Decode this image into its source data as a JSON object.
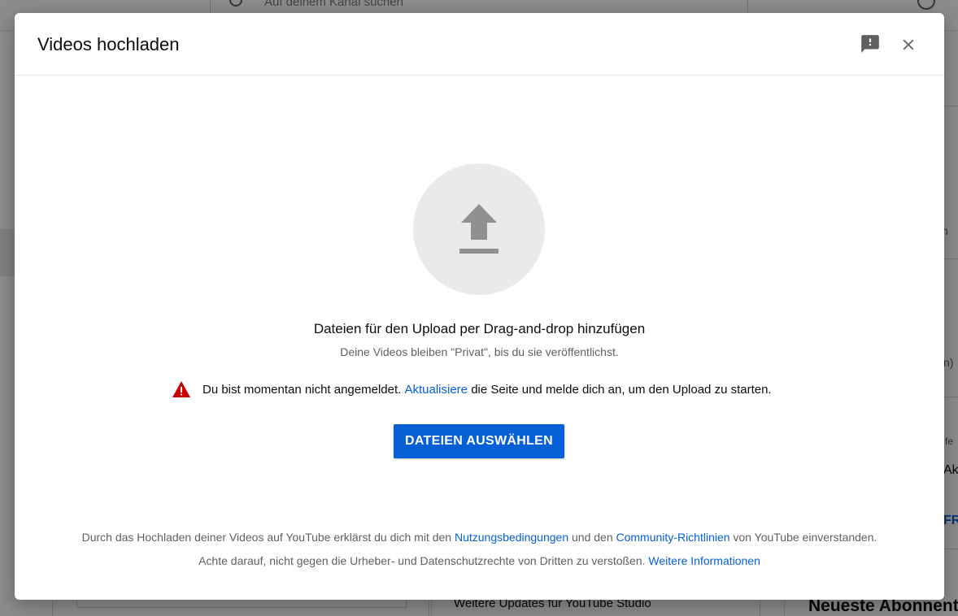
{
  "background": {
    "search_placeholder": "Auf deinem Kanal suchen",
    "updates_heading": "Weitere Updates für YouTube Studio",
    "subscribers_heading": "Neueste Abonnenten",
    "fragments": [
      "n",
      "n)",
      "fe",
      "Ak",
      "FR"
    ]
  },
  "dialog": {
    "title": "Videos hochladen",
    "feedback_icon": "feedback-icon",
    "close_icon": "close-icon",
    "upload_icon": "upload-arrow-icon",
    "drop_title": "Dateien für den Upload per Drag-and-drop hinzufügen",
    "drop_subtitle": "Deine Videos bleiben \"Privat\", bis du sie veröffentlichst.",
    "warning": {
      "icon": "warning-icon",
      "text_before": "Du bist momentan nicht angemeldet.",
      "link": "Aktualisiere",
      "text_after": "die Seite und melde dich an, um den Upload zu starten."
    },
    "select_button": "DATEIEN AUSWÄHLEN",
    "footer": {
      "line1_part1": "Durch das Hochladen deiner Videos auf YouTube erklärst du dich mit den",
      "line1_link1": "Nutzungsbedingungen",
      "line1_part2": "und den",
      "line1_link2": "Community-Richtlinien",
      "line1_part3": "von YouTube einverstanden.",
      "line2_text": "Achte darauf, nicht gegen die Urheber- und Datenschutzrechte von Dritten zu verstoßen.",
      "line2_link": "Weitere Informationen"
    }
  },
  "colors": {
    "accent": "#065fd4",
    "warning_red": "#cc0000",
    "icon_gray": "#606060",
    "upload_circle": "#eaeaea"
  }
}
